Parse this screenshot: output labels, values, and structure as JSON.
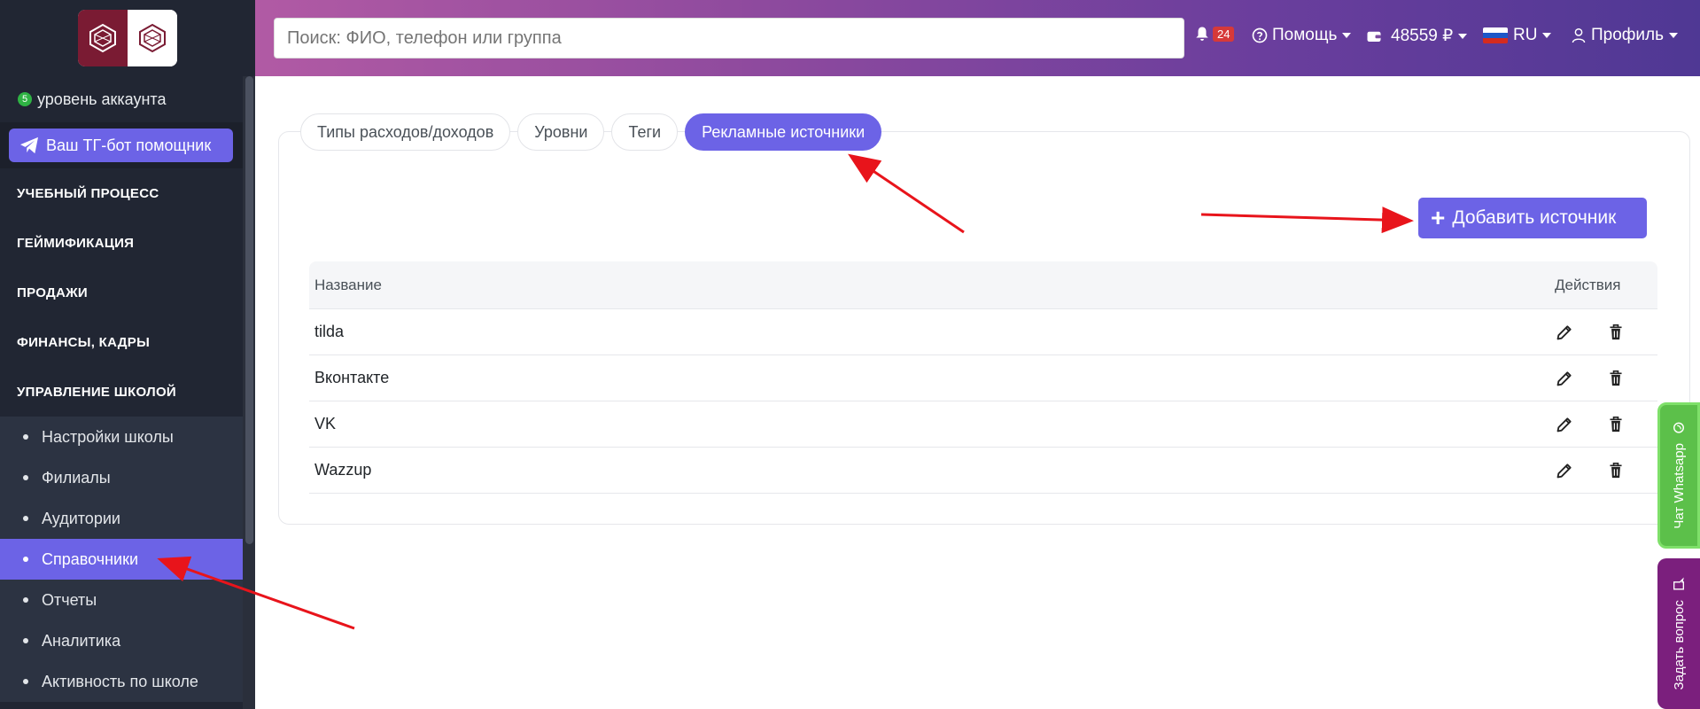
{
  "sidebar": {
    "account_level_num": "5",
    "account_level_text": "уровень аккаунта",
    "tg_button": "Ваш ТГ-бот помощник",
    "sections": [
      "УЧЕБНЫЙ ПРОЦЕСС",
      "ГЕЙМИФИКАЦИЯ",
      "ПРОДАЖИ",
      "ФИНАНСЫ, КАДРЫ",
      "УПРАВЛЕНИЕ ШКОЛОЙ"
    ],
    "submenu": [
      "Настройки школы",
      "Филиалы",
      "Аудитории",
      "Справочники",
      "Отчеты",
      "Аналитика",
      "Активность по школе"
    ],
    "active_submenu": "Справочники"
  },
  "header": {
    "search_placeholder": "Поиск: ФИО, телефон или группа",
    "notifications_count": "24",
    "help": "Помощь",
    "balance": "48559 ₽",
    "language": "RU",
    "profile": "Профиль"
  },
  "tabs": [
    {
      "label": "Типы расходов/доходов",
      "active": false
    },
    {
      "label": "Уровни",
      "active": false
    },
    {
      "label": "Теги",
      "active": false
    },
    {
      "label": "Рекламные источники",
      "active": true
    }
  ],
  "add_button": "Добавить источник",
  "table": {
    "col_name": "Название",
    "col_actions": "Действия",
    "rows": [
      "tilda",
      "Вконтакте",
      "VK",
      "Wazzup"
    ]
  },
  "floating": {
    "whatsapp": "Чат Whatsapp",
    "question": "Задать вопрос"
  },
  "colors": {
    "accent": "#6c63e6",
    "sidebar_bg": "#212633",
    "annotation_arrow": "#e8141b"
  }
}
